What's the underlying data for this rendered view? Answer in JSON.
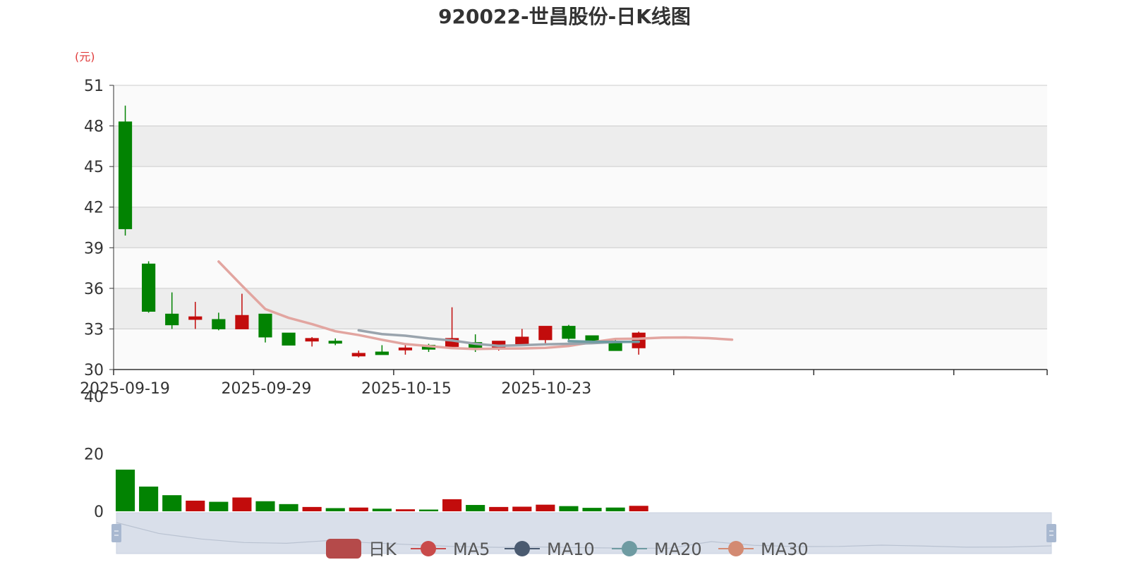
{
  "chart_data": {
    "type": "candlestick",
    "title": "920022-世昌股份-日K线图",
    "y_unit": "(元)",
    "price_ylim": [
      30,
      51
    ],
    "price_yticks": [
      30,
      33,
      36,
      39,
      42,
      45,
      48,
      51
    ],
    "volume_ylim": [
      0,
      40
    ],
    "volume_yticks": [
      0,
      20,
      40
    ],
    "x_tick_labels": [
      "2025-09-19",
      "2025-09-29",
      "2025-10-15",
      "2025-10-23"
    ],
    "x_tick_label_indices": [
      0,
      6,
      12,
      18
    ],
    "total_slots": 40,
    "candles": [
      {
        "open": 48.3,
        "close": 40.4,
        "high": 49.5,
        "low": 39.9,
        "volume": 14.5
      },
      {
        "open": 37.8,
        "close": 34.3,
        "high": 38.0,
        "low": 34.2,
        "volume": 8.6
      },
      {
        "open": 34.1,
        "close": 33.3,
        "high": 35.7,
        "low": 33.0,
        "volume": 5.6
      },
      {
        "open": 33.7,
        "close": 33.9,
        "high": 35.0,
        "low": 33.0,
        "volume": 3.7
      },
      {
        "open": 33.7,
        "close": 33.0,
        "high": 34.2,
        "low": 32.9,
        "volume": 3.3
      },
      {
        "open": 33.0,
        "close": 34.0,
        "high": 35.6,
        "low": 33.0,
        "volume": 4.8
      },
      {
        "open": 34.1,
        "close": 32.4,
        "high": 34.1,
        "low": 32.0,
        "volume": 3.5
      },
      {
        "open": 32.7,
        "close": 31.8,
        "high": 32.7,
        "low": 31.8,
        "volume": 2.5
      },
      {
        "open": 32.1,
        "close": 32.3,
        "high": 32.4,
        "low": 31.7,
        "volume": 1.5
      },
      {
        "open": 32.1,
        "close": 32.0,
        "high": 32.3,
        "low": 31.8,
        "volume": 1.1
      },
      {
        "open": 31.0,
        "close": 31.2,
        "high": 31.4,
        "low": 30.9,
        "volume": 1.3
      },
      {
        "open": 31.3,
        "close": 31.1,
        "high": 31.8,
        "low": 31.1,
        "volume": 0.9
      },
      {
        "open": 31.5,
        "close": 31.6,
        "high": 31.8,
        "low": 31.1,
        "volume": 0.7
      },
      {
        "open": 31.8,
        "close": 31.5,
        "high": 31.9,
        "low": 31.3,
        "volume": 0.6
      },
      {
        "open": 31.7,
        "close": 32.3,
        "high": 34.6,
        "low": 31.7,
        "volume": 4.2
      },
      {
        "open": 32.0,
        "close": 31.6,
        "high": 32.6,
        "low": 31.3,
        "volume": 2.2
      },
      {
        "open": 31.6,
        "close": 32.1,
        "high": 32.1,
        "low": 31.4,
        "volume": 1.5
      },
      {
        "open": 31.9,
        "close": 32.4,
        "high": 33.0,
        "low": 31.8,
        "volume": 1.6
      },
      {
        "open": 32.2,
        "close": 33.2,
        "high": 33.2,
        "low": 31.8,
        "volume": 2.3
      },
      {
        "open": 33.2,
        "close": 32.3,
        "high": 33.3,
        "low": 32.2,
        "volume": 1.8
      },
      {
        "open": 32.5,
        "close": 32.1,
        "high": 32.5,
        "low": 32.1,
        "volume": 1.2
      },
      {
        "open": 32.1,
        "close": 31.4,
        "high": 32.3,
        "low": 31.4,
        "volume": 1.3
      },
      {
        "open": 31.6,
        "close": 32.7,
        "high": 32.8,
        "low": 31.1,
        "volume": 1.9
      }
    ],
    "series": [
      {
        "name": "MA5",
        "color": "#e2a5a0",
        "start_index": 4,
        "values": [
          37.98,
          36.2,
          34.47,
          33.82,
          33.36,
          32.83,
          32.55,
          32.2,
          31.88,
          31.73,
          31.58,
          31.52,
          31.55,
          31.56,
          31.6,
          31.74,
          32.02,
          32.26,
          32.28,
          32.36,
          32.37,
          32.32,
          32.21
        ]
      },
      {
        "name": "MA10",
        "color": "#9aa4ad",
        "start_index": 10,
        "values": [
          32.9,
          32.62,
          32.5,
          32.3,
          32.15,
          31.9,
          31.75,
          31.8,
          31.86,
          31.9,
          31.95,
          32.04,
          32.05
        ]
      },
      {
        "name": "MA20",
        "color": "#6e9ba2",
        "start_index": 19,
        "values": [
          32.1,
          32.05,
          32.04,
          32.05
        ]
      },
      {
        "name": "MA30",
        "color": "#d38a72",
        "start_index": 22,
        "values": [
          32.2
        ]
      }
    ],
    "legend": [
      "日K",
      "MA5",
      "MA10",
      "MA20",
      "MA30"
    ],
    "legend_position": "bottom-center",
    "colors": {
      "up": "#c20c0c",
      "down": "#028302",
      "grid_light": "#fafafa",
      "grid_dark": "#ededed",
      "axis": "#333333",
      "unit_text": "#e03c3c",
      "dataZoom_fill": "#d9dfea",
      "dataZoom_handle": "#a8b8d0",
      "legend_kline": "#b54a4a",
      "legend_ma5": "#c94a4a",
      "legend_ma10": "#4a5a70",
      "legend_ma20": "#6e9ba2",
      "legend_ma30": "#d38a72"
    },
    "grid": true
  }
}
